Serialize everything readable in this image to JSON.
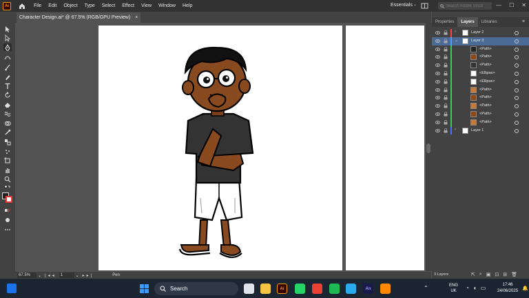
{
  "app": {
    "logo_text": "Ai",
    "menu": [
      "File",
      "Edit",
      "Object",
      "Type",
      "Select",
      "Effect",
      "View",
      "Window",
      "Help"
    ],
    "workspace": "Essentials",
    "search_placeholder": "Search Adobe Stock"
  },
  "document": {
    "tab_title": "Character Design.ai* @ 67.5% (RGB/GPU Preview)",
    "close": "×"
  },
  "status": {
    "zoom": "67.5%",
    "page": "1",
    "tool": "Pen"
  },
  "panel": {
    "tabs": [
      "Properties",
      "Layers",
      "Libraries"
    ],
    "active_tab": "Layers",
    "layers": [
      {
        "name": "Layer 2",
        "color": "#ff4444",
        "level": 0,
        "expanded": false,
        "selected": false
      },
      {
        "name": "Layer 3",
        "color": "#4f9fff",
        "level": 0,
        "expanded": true,
        "selected": true
      },
      {
        "name": "<Path>",
        "color": "#3dcc5c",
        "level": 1,
        "selected": false
      },
      {
        "name": "<Path>",
        "color": "#3dcc5c",
        "level": 1,
        "selected": false
      },
      {
        "name": "<Path>",
        "color": "#3dcc5c",
        "level": 1,
        "selected": false
      },
      {
        "name": "<Ellipse>",
        "color": "#3dcc5c",
        "level": 1,
        "selected": false
      },
      {
        "name": "<Ellipse>",
        "color": "#3dcc5c",
        "level": 1,
        "selected": false
      },
      {
        "name": "<Path>",
        "color": "#3dcc5c",
        "level": 1,
        "selected": false
      },
      {
        "name": "<Path>",
        "color": "#3dcc5c",
        "level": 1,
        "selected": false
      },
      {
        "name": "<Path>",
        "color": "#3dcc5c",
        "level": 1,
        "selected": false
      },
      {
        "name": "<Path>",
        "color": "#3dcc5c",
        "level": 1,
        "selected": false
      },
      {
        "name": "<Path>",
        "color": "#3dcc5c",
        "level": 1,
        "selected": false
      },
      {
        "name": "Layer 1",
        "color": "#4f6fff",
        "level": 0,
        "expanded": false,
        "selected": false
      }
    ],
    "layer_count": "3 Layers"
  },
  "taskbar": {
    "search": "Search",
    "lang_top": "ENG",
    "lang_bottom": "UK",
    "time": "17:46",
    "date": "24/06/2025",
    "apps": [
      {
        "name": "file-explorer",
        "label": "",
        "color": "#f5c542"
      },
      {
        "name": "illustrator",
        "label": "Ai",
        "color": "#330000"
      },
      {
        "name": "whatsapp",
        "label": "",
        "color": "#25d366"
      },
      {
        "name": "chrome",
        "label": "",
        "color": "#ea4335"
      },
      {
        "name": "spotify",
        "label": "",
        "color": "#1db954"
      },
      {
        "name": "telegram",
        "label": "",
        "color": "#2aabee"
      },
      {
        "name": "animate",
        "label": "An",
        "color": "#1a1a4e"
      },
      {
        "name": "vlc",
        "label": "",
        "color": "#ff8800"
      }
    ]
  }
}
